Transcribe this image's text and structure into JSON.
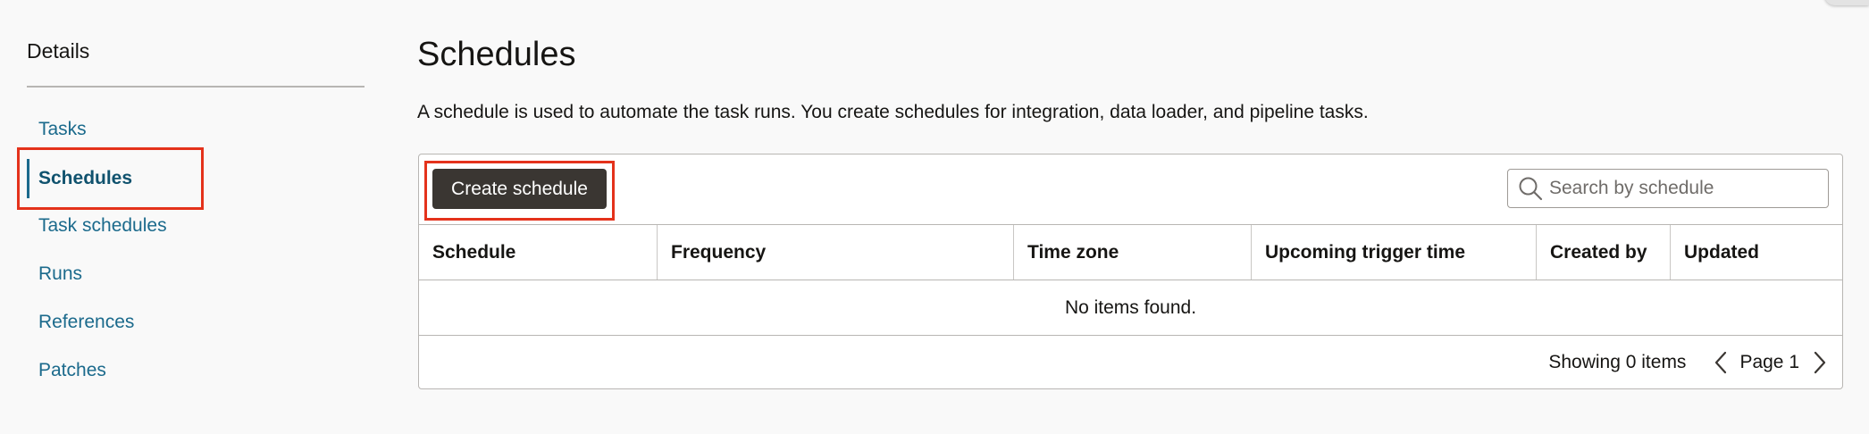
{
  "sidebar": {
    "heading": "Details",
    "items": [
      {
        "label": "Tasks"
      },
      {
        "label": "Schedules",
        "selected": true
      },
      {
        "label": "Task schedules"
      },
      {
        "label": "Runs"
      },
      {
        "label": "References"
      },
      {
        "label": "Patches"
      }
    ]
  },
  "main": {
    "title": "Schedules",
    "description": "A schedule is used to automate the task runs. You create schedules for integration, data loader, and pipeline tasks."
  },
  "toolbar": {
    "create_label": "Create schedule",
    "search_placeholder": "Search by schedule",
    "search_value": ""
  },
  "table": {
    "columns": [
      "Schedule",
      "Frequency",
      "Time zone",
      "Upcoming trigger time",
      "Created by",
      "Updated"
    ],
    "rows": [],
    "empty_message": "No items found."
  },
  "pagination": {
    "showing": "Showing 0 items",
    "page_label": "Page 1"
  },
  "colors": {
    "link": "#1b6a8c",
    "primary_button": "#3a3632",
    "annotation": "#e4321b"
  },
  "icons": {
    "search": "search-icon",
    "previous": "chevron-left-icon",
    "next": "chevron-right-icon"
  }
}
